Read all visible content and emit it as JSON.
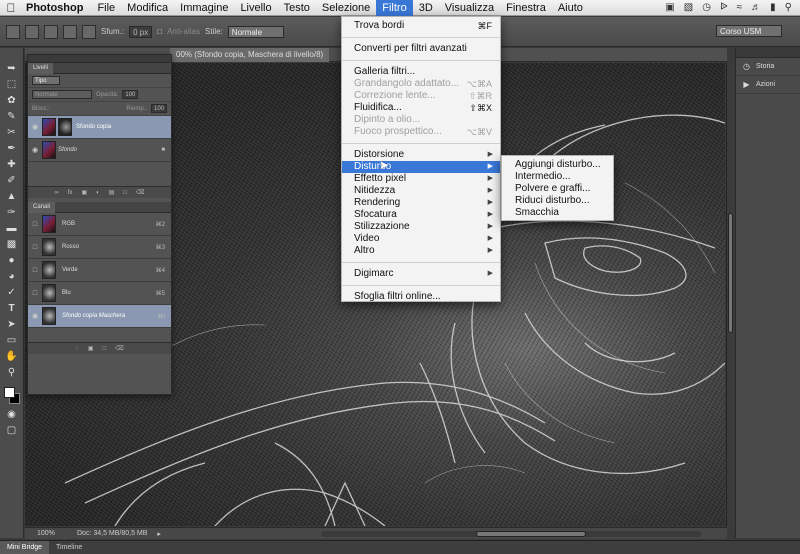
{
  "menubar": {
    "app_name": "Photoshop",
    "items": [
      "File",
      "Modifica",
      "Immagine",
      "Livello",
      "Testo",
      "Selezione",
      "Filtro",
      "3D",
      "Visualizza",
      "Finestra",
      "Aiuto"
    ],
    "active_item": "Filtro"
  },
  "options": {
    "feather_label": "Sfum.:",
    "feather_value": "0 px",
    "antialias_label": "Anti-alias",
    "style_label": "Stile:",
    "style_value": "Normale",
    "workspace": "Corso USM"
  },
  "document": {
    "tab_title": "00% (Sfondo copia, Maschera di livello/8)"
  },
  "status": {
    "zoom": "100%",
    "doc_size": "Doc: 34,5 MB/80,5 MB"
  },
  "bottom_tabs": [
    "Mini Bridge",
    "Timeline"
  ],
  "right_dock": {
    "items": [
      {
        "label": "Storia",
        "icon": "history-icon"
      },
      {
        "label": "Azioni",
        "icon": "play-icon"
      }
    ]
  },
  "layers_panel": {
    "tab": "Livelli",
    "filter_label": "Tipo",
    "blend_mode": "Normale",
    "opacity_label": "Opacità:",
    "opacity_value": "100",
    "lock_label": "Blocc.:",
    "fill_label": "Riemp.:",
    "fill_value": "100",
    "layers": [
      {
        "name": "Sfondo copia",
        "selected": true
      },
      {
        "name": "Sfondo",
        "selected": false
      }
    ]
  },
  "channels_panel": {
    "tab": "Canali",
    "channels": [
      {
        "name": "RGB",
        "shortcut": "⌘2",
        "selected": false
      },
      {
        "name": "Rosso",
        "shortcut": "⌘3",
        "selected": false
      },
      {
        "name": "Verde",
        "shortcut": "⌘4",
        "selected": false
      },
      {
        "name": "Blu",
        "shortcut": "⌘5",
        "selected": false
      },
      {
        "name": "Sfondo copia Maschera",
        "shortcut": "⌘\\",
        "selected": true
      }
    ]
  },
  "filter_menu": {
    "groups": [
      [
        {
          "label": "Trova bordi",
          "shortcut": "⌘F"
        }
      ],
      [
        {
          "label": "Converti per filtri avanzati"
        }
      ],
      [
        {
          "label": "Galleria filtri..."
        },
        {
          "label": "Grandangolo adattato...",
          "shortcut": "⌥⌘A",
          "disabled": true
        },
        {
          "label": "Correzione lente...",
          "shortcut": "⇧⌘R",
          "disabled": true
        },
        {
          "label": "Fluidifica...",
          "shortcut": "⇧⌘X"
        },
        {
          "label": "Dipinto a olio...",
          "disabled": true
        },
        {
          "label": "Fuoco prospettico...",
          "shortcut": "⌥⌘V",
          "disabled": true
        }
      ],
      [
        {
          "label": "Distorsione",
          "submenu": true
        },
        {
          "label": "Disturbo",
          "submenu": true,
          "highlighted": true
        },
        {
          "label": "Effetto pixel",
          "submenu": true
        },
        {
          "label": "Nitidezza",
          "submenu": true
        },
        {
          "label": "Rendering",
          "submenu": true
        },
        {
          "label": "Sfocatura",
          "submenu": true
        },
        {
          "label": "Stilizzazione",
          "submenu": true
        },
        {
          "label": "Video",
          "submenu": true
        },
        {
          "label": "Altro",
          "submenu": true
        }
      ],
      [
        {
          "label": "Digimarc",
          "submenu": true
        }
      ],
      [
        {
          "label": "Sfoglia filtri online..."
        }
      ]
    ]
  },
  "noise_submenu": {
    "items": [
      "Aggiungi disturbo...",
      "Intermedio...",
      "Polvere e graffi...",
      "Riduci disturbo...",
      "Smacchia"
    ]
  }
}
